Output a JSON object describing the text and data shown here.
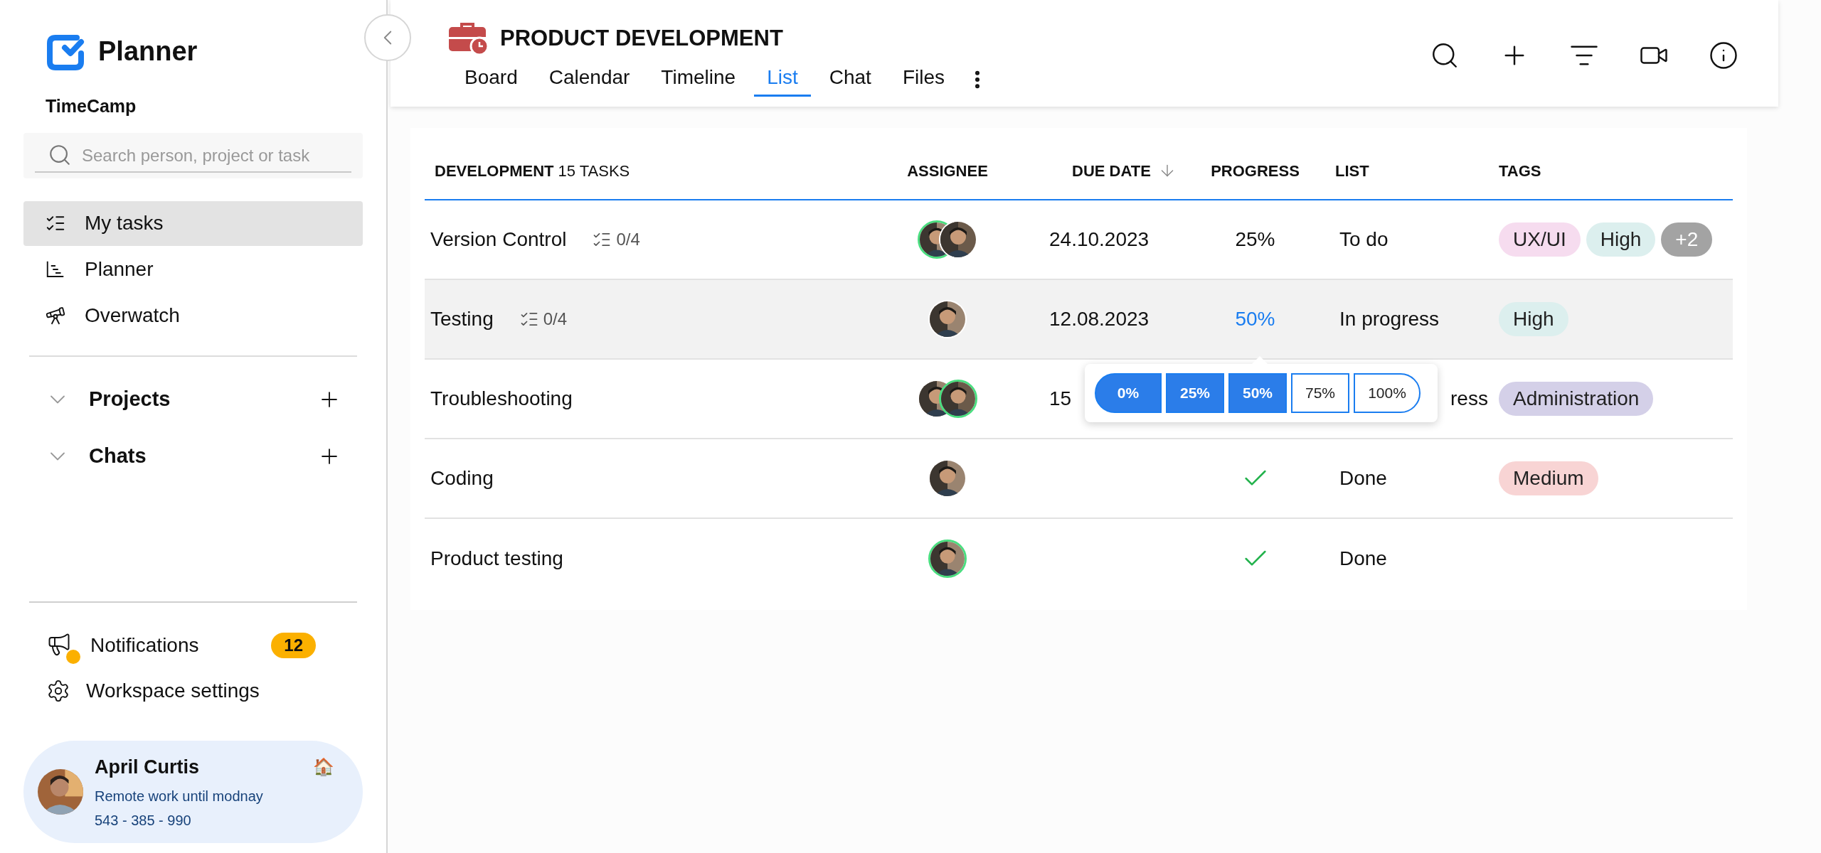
{
  "sidebar": {
    "app_name": "Planner",
    "workspace": "TimeCamp",
    "search": {
      "placeholder": "Search person, project or task"
    },
    "nav": [
      {
        "label": "My tasks",
        "kind": "tasks",
        "selected": true
      },
      {
        "label": "Planner",
        "kind": "planner",
        "selected": false
      },
      {
        "label": "Overwatch",
        "kind": "overwatch",
        "selected": false
      }
    ],
    "sections": [
      {
        "label": "Projects",
        "expanded": false
      },
      {
        "label": "Chats",
        "expanded": false
      }
    ],
    "notifications": {
      "label": "Notifications",
      "count": "12",
      "unread": true
    },
    "settings": {
      "label": "Workspace settings"
    },
    "profile": {
      "name": "April Curtis",
      "status_emoji": "🏠",
      "status": "Remote work until modnay",
      "phone": "543 - 385 - 990"
    }
  },
  "project": {
    "title": "PRODUCT DEVELOPMENT",
    "tabs": [
      {
        "label": "Board",
        "selected": false
      },
      {
        "label": "Calendar",
        "selected": false
      },
      {
        "label": "Timeline",
        "selected": false
      },
      {
        "label": "List",
        "selected": true
      },
      {
        "label": "Chat",
        "selected": false
      },
      {
        "label": "Files",
        "selected": false
      }
    ]
  },
  "table": {
    "group": "DEVELOPMENT",
    "count": "15 TASKS",
    "columns": [
      "ASSIGNEE",
      "DUE DATE",
      "PROGRESS",
      "LIST",
      "TAGS"
    ],
    "rows": [
      {
        "name": "Version Control",
        "subtasks": "0/4",
        "selected": false,
        "assignees": [
          {
            "online": true
          },
          {
            "online": false
          }
        ],
        "due": "24.10.2023",
        "progress": {
          "kind": "percent",
          "text": "25%",
          "active": false
        },
        "list": "To do",
        "tags": [
          {
            "label": "UX/UI",
            "color": "#f6dcef"
          },
          {
            "label": "High",
            "color": "#dcefee"
          },
          {
            "label": "+2",
            "color": "#a3a3a3"
          }
        ]
      },
      {
        "name": "Testing",
        "subtasks": "0/4",
        "selected": true,
        "assignees": [
          {
            "online": false
          }
        ],
        "due": "12.08.2023",
        "progress": {
          "kind": "percent",
          "text": "50%",
          "active": true
        },
        "list": "In progress",
        "tags": [
          {
            "label": "High",
            "color": "#dcefee"
          }
        ],
        "popup": [
          {
            "label": "0%",
            "filled": true
          },
          {
            "label": "25%",
            "filled": true
          },
          {
            "label": "50%",
            "filled": true
          },
          {
            "label": "75%",
            "filled": false
          },
          {
            "label": "100%",
            "filled": false
          }
        ]
      },
      {
        "name": "Troubleshooting",
        "selected": false,
        "assignees": [
          {
            "online": false
          },
          {
            "online": true
          }
        ],
        "due": "15",
        "list": "ress",
        "tags": [
          {
            "label": "Administration",
            "color": "#d4d0e8"
          }
        ]
      },
      {
        "name": "Coding",
        "selected": false,
        "assignees": [
          {
            "online": false
          }
        ],
        "progress": {
          "kind": "done"
        },
        "list": "Done",
        "tags": [
          {
            "label": "Medium",
            "color": "#f8d4d4"
          }
        ]
      },
      {
        "name": "Product testing",
        "selected": false,
        "assignees": [
          {
            "online": true
          }
        ],
        "progress": {
          "kind": "done"
        },
        "list": "Done",
        "tags": []
      }
    ]
  }
}
